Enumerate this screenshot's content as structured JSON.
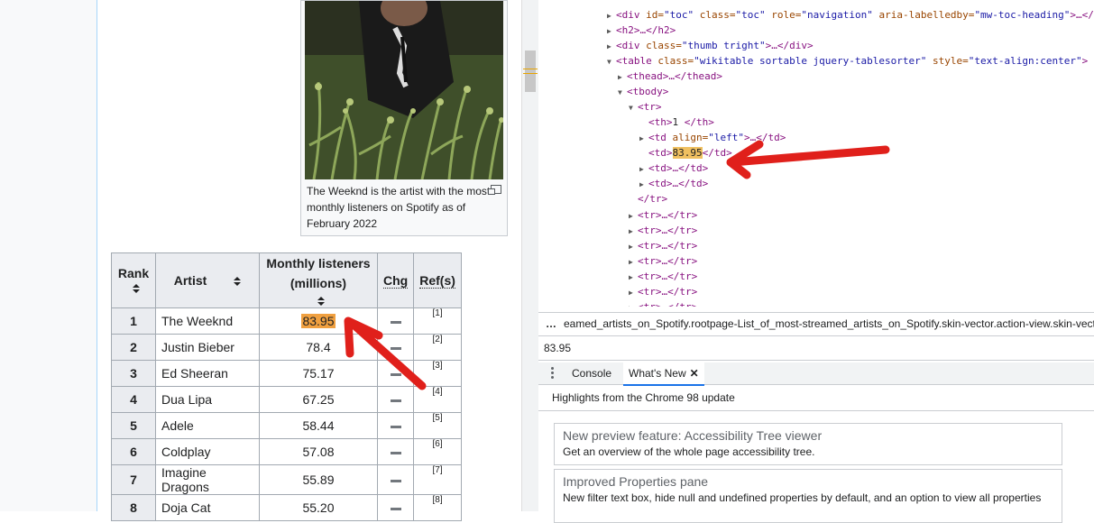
{
  "wiki": {
    "thumb_caption": "The Weeknd is the artist with the most monthly listeners on Spotify as of February 2022",
    "table": {
      "headers": {
        "rank": "Rank",
        "artist": "Artist",
        "listeners_line1": "Monthly listeners",
        "listeners_line2": "(millions)",
        "chg": "Chg",
        "refs": "Ref(s)"
      },
      "rows": [
        {
          "rank": "1",
          "artist": "The Weeknd",
          "listeners": "83.95",
          "ref": "[1]"
        },
        {
          "rank": "2",
          "artist": "Justin Bieber",
          "listeners": "78.4",
          "ref": "[2]"
        },
        {
          "rank": "3",
          "artist": "Ed Sheeran",
          "listeners": "75.17",
          "ref": "[3]"
        },
        {
          "rank": "4",
          "artist": "Dua Lipa",
          "listeners": "67.25",
          "ref": "[4]"
        },
        {
          "rank": "5",
          "artist": "Adele",
          "listeners": "58.44",
          "ref": "[5]"
        },
        {
          "rank": "6",
          "artist": "Coldplay",
          "listeners": "57.08",
          "ref": "[6]"
        },
        {
          "rank": "7",
          "artist": "Imagine Dragons",
          "listeners": "55.89",
          "ref": "[7]"
        },
        {
          "rank": "8",
          "artist": "Doja Cat",
          "listeners": "55.20",
          "ref": "[8]"
        }
      ]
    }
  },
  "devtools": {
    "dom": {
      "l1_tag": "<div ",
      "l1_a1": "id=",
      "l1_v1": "\"toc\"",
      "l1_a2": " class=",
      "l1_v2": "\"toc\"",
      "l1_a3": " role=",
      "l1_v3": "\"navigation\"",
      "l1_a4": " aria-labelledby=",
      "l1_v4": "\"mw-toc-heading\"",
      "l1_end": ">…</",
      "l2": "<h2>…</h2>",
      "l3_tag": "<div ",
      "l3_a1": "class=",
      "l3_v1": "\"thumb tright\"",
      "l3_end": ">…</div>",
      "l4_tag": "<table ",
      "l4_a1": "class=",
      "l4_v1": "\"wikitable sortable jquery-tablesorter\"",
      "l4_a2": " style=",
      "l4_v2": "\"text-align:center\"",
      "l4_end": ">",
      "l5": "<thead>…</thead>",
      "l6": "<tbody>",
      "l7": "<tr>",
      "l8_open": "<th>",
      "l8_text": "1 ",
      "l8_close": "</th>",
      "l9_tag": "<td ",
      "l9_a1": "align=",
      "l9_v1": "\"left\"",
      "l9_end": ">…</td>",
      "l10_open": "<td>",
      "l10_text": "83.95",
      "l10_close": "</td>",
      "l11": "<td>…</td>",
      "l12": "<td>…</td>",
      "l13": "</tr>",
      "tr_collapsed": "<tr>…</tr>"
    },
    "breadcrumb": "eamed_artists_on_Spotify.rootpage-List_of_most-streamed_artists_on_Spotify.skin-vector.action-view.skin-vecto",
    "search_value": "83.95",
    "tabs": {
      "console": "Console",
      "whats_new": "What's New"
    },
    "whats_new_heading": "Highlights from the Chrome 98 update",
    "cards": [
      {
        "title": "New preview feature: Accessibility Tree viewer",
        "desc": "Get an overview of the whole page accessibility tree."
      },
      {
        "title": "Improved Properties pane",
        "desc": "New filter text box, hide null and undefined properties by default, and an option to view all properties"
      }
    ]
  },
  "colors": {
    "annotation_red": "#e0201b",
    "highlight": "#f0a040"
  }
}
